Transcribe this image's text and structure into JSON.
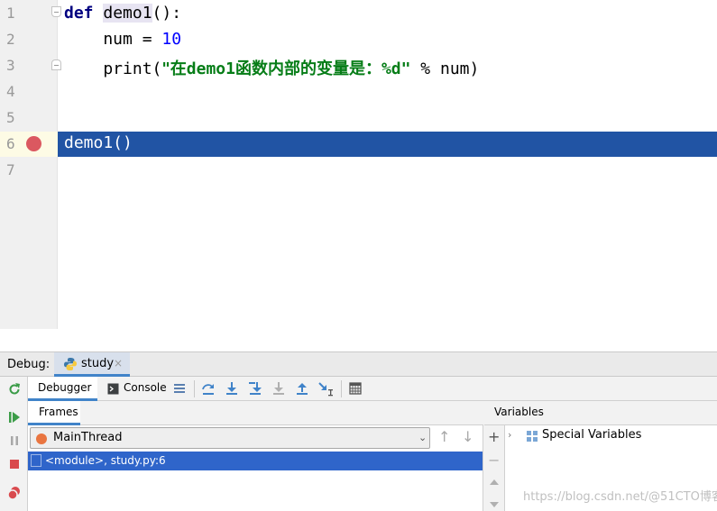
{
  "editor": {
    "line_numbers": [
      "1",
      "2",
      "3",
      "4",
      "5",
      "6",
      "7"
    ],
    "line1": {
      "def": "def",
      "fn_name": "demo1",
      "rest": "():"
    },
    "line2": {
      "indent_var": "    num = ",
      "value": "10"
    },
    "line3": {
      "start": "    print(",
      "string_open": "\"在",
      "string_mid": "demo1",
      "string_cjk": "函数内部的变量是：",
      "string_end": "%d\"",
      "tail": " % num)"
    },
    "line6": "demo1()"
  },
  "debug": {
    "label": "Debug:",
    "session_tab": "study",
    "close_symbol": "×",
    "tabs": {
      "debugger": "Debugger",
      "console": "Console"
    },
    "frames": {
      "tab": "Frames",
      "thread": "MainThread",
      "chevron": "⌄",
      "up_arrow": "↑",
      "down_arrow": "↓",
      "selected_frame": "<module>, study.py:6"
    },
    "variables": {
      "tab": "Variables",
      "add_symbol": "+",
      "remove_symbol": "−",
      "expand_symbol": "›",
      "special_variables": "Special Variables"
    }
  },
  "watermark": "https://blog.csdn.net/@51CTO博客",
  "colors": {
    "execution_line": "#2154a4",
    "breakpoint": "#db5860",
    "selection": "#2f65ca",
    "keyword": "#000080",
    "number": "#0000ff",
    "string": "#067d17"
  },
  "icons": {
    "rerun": "rerun-icon",
    "resume": "resume-icon",
    "pause": "pause-icon",
    "stop": "stop-icon",
    "breakpoints": "view-breakpoints-icon",
    "python": "python-icon"
  }
}
